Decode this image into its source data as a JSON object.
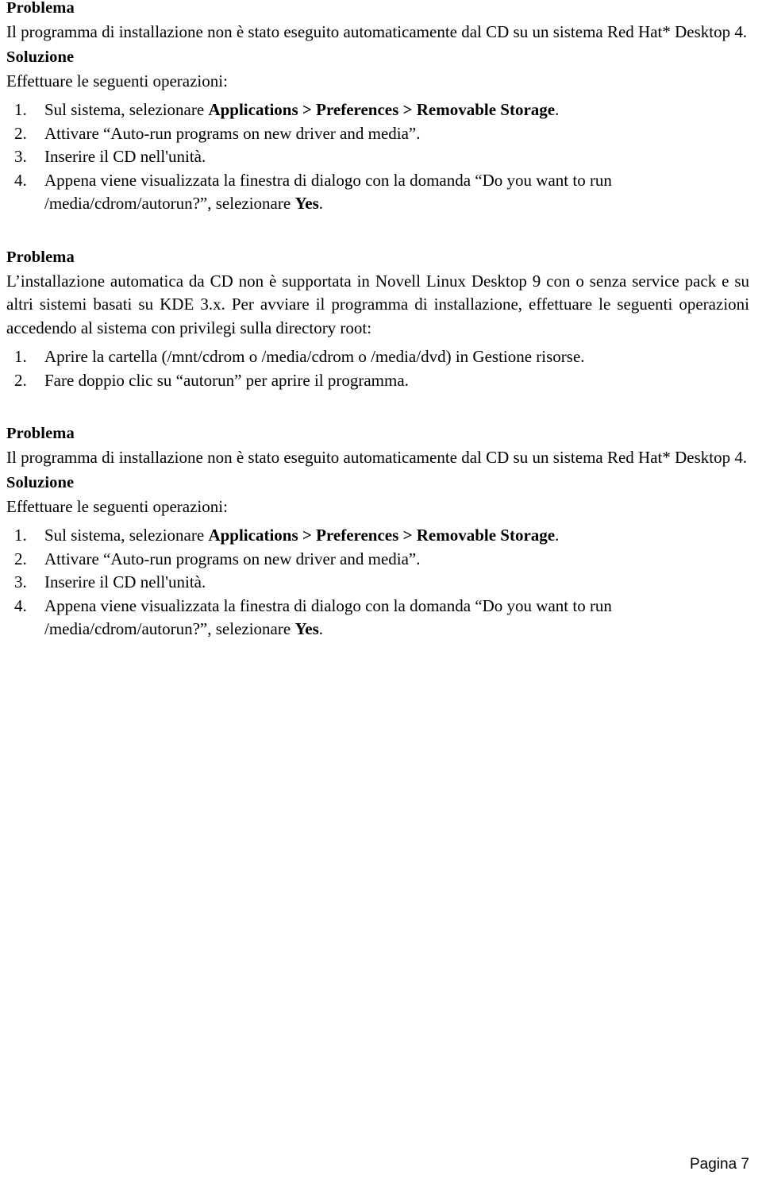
{
  "document": {
    "language": "it",
    "page_footer": "Pagina 7",
    "text_color": "#000000",
    "background_color": "#ffffff"
  },
  "sections": [
    {
      "id": "section-1",
      "problem_heading": "Problema",
      "problem_text": "Il programma di installazione non è stato eseguito automaticamente dal CD su un sistema Red Hat* Desktop 4.",
      "solution_heading": "Soluzione",
      "solution_intro": "Effettuare le seguenti operazioni:",
      "steps": [
        {
          "number": "1.",
          "parts": [
            {
              "text": "Sul sistema, selezionare ",
              "bold": false
            },
            {
              "text": "Applications > Preferences > Removable Storage",
              "bold": true
            },
            {
              "text": ".",
              "bold": false
            }
          ]
        },
        {
          "number": "2.",
          "parts": [
            {
              "text": "Attivare “Auto-run programs on new driver and media”.",
              "bold": false
            }
          ]
        },
        {
          "number": "3.",
          "parts": [
            {
              "text": "Inserire il CD nell'unità.",
              "bold": false
            }
          ]
        },
        {
          "number": "4.",
          "parts": [
            {
              "text": "Appena viene visualizzata la finestra di dialogo con la domanda “Do you want to run /media/cdrom/autorun?”, selezionare ",
              "bold": false
            },
            {
              "text": "Yes",
              "bold": true
            },
            {
              "text": ".",
              "bold": false
            }
          ]
        }
      ]
    },
    {
      "id": "section-2",
      "problem_heading": "Problema",
      "problem_text": "L’installazione automatica da CD non è supportata in Novell Linux Desktop 9 con o senza service pack e su altri sistemi basati su KDE 3.x. Per avviare il programma di installazione, effettuare le seguenti operazioni accedendo al sistema con privilegi sulla directory root:",
      "solution_heading": null,
      "solution_intro": null,
      "steps": [
        {
          "number": "1.",
          "parts": [
            {
              "text": "Aprire la cartella (/mnt/cdrom o /media/cdrom o /media/dvd) in Gestione risorse.",
              "bold": false
            }
          ]
        },
        {
          "number": "2.",
          "parts": [
            {
              "text": "Fare doppio clic su “autorun” per aprire il programma.",
              "bold": false
            }
          ]
        }
      ]
    },
    {
      "id": "section-3",
      "problem_heading": "Problema",
      "problem_text": "Il programma di installazione non è stato eseguito automaticamente dal CD su un sistema Red Hat* Desktop 4.",
      "solution_heading": "Soluzione",
      "solution_intro": "Effettuare le seguenti operazioni:",
      "steps": [
        {
          "number": "1.",
          "parts": [
            {
              "text": "Sul sistema, selezionare ",
              "bold": false
            },
            {
              "text": "Applications > Preferences > Removable Storage",
              "bold": true
            },
            {
              "text": ".",
              "bold": false
            }
          ]
        },
        {
          "number": "2.",
          "parts": [
            {
              "text": "Attivare “Auto-run programs on new driver and media”.",
              "bold": false
            }
          ]
        },
        {
          "number": "3.",
          "parts": [
            {
              "text": "Inserire il CD nell'unità.",
              "bold": false
            }
          ]
        },
        {
          "number": "4.",
          "parts": [
            {
              "text": "Appena viene visualizzata la finestra di dialogo con la domanda “Do you want to run /media/cdrom/autorun?”, selezionare ",
              "bold": false
            },
            {
              "text": "Yes",
              "bold": true
            },
            {
              "text": ".",
              "bold": false
            }
          ]
        }
      ]
    }
  ]
}
